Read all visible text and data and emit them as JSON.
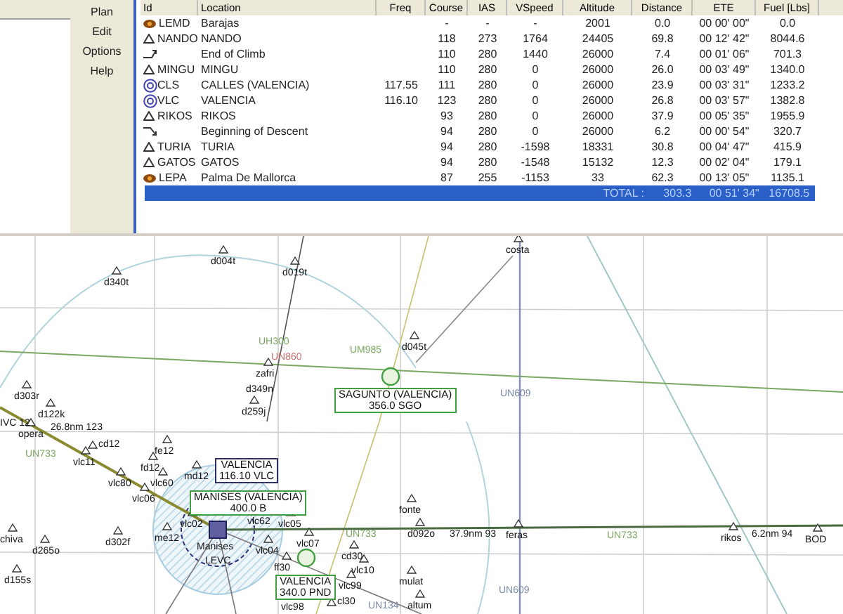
{
  "menu": [
    {
      "label": "Plan"
    },
    {
      "label": "Edit"
    },
    {
      "label": "Options"
    },
    {
      "label": "Help"
    }
  ],
  "table": {
    "columns": [
      "Id",
      "Location",
      "Freq",
      "Course",
      "IAS",
      "VSpeed",
      "Altitude",
      "Distance",
      "ETE",
      "Fuel [Lbs]"
    ],
    "rows": [
      {
        "kind": "airport",
        "id": "LEMD",
        "location": "Barajas",
        "freq": "",
        "course": "-",
        "ias": "-",
        "vspeed": "-",
        "altitude": "2001",
        "distance": "0.0",
        "ete": "00 00' 00\"",
        "fuel": "0.0"
      },
      {
        "kind": "waypoint",
        "id": "NANDO",
        "location": "NANDO",
        "freq": "",
        "course": "118",
        "ias": "273",
        "vspeed": "1764",
        "altitude": "24405",
        "distance": "69.8",
        "ete": "00 12' 42\"",
        "fuel": "8044.6"
      },
      {
        "kind": "climb",
        "id": "",
        "location": "End of Climb",
        "freq": "",
        "course": "110",
        "ias": "280",
        "vspeed": "1440",
        "altitude": "26000",
        "distance": "7.4",
        "ete": "00 01' 06\"",
        "fuel": "701.3"
      },
      {
        "kind": "waypoint",
        "id": "MINGU",
        "location": "MINGU",
        "freq": "",
        "course": "110",
        "ias": "280",
        "vspeed": "0",
        "altitude": "26000",
        "distance": "26.0",
        "ete": "00 03' 49\"",
        "fuel": "1340.0"
      },
      {
        "kind": "vor",
        "id": "CLS",
        "location": "CALLES (VALENCIA)",
        "freq": "117.55",
        "course": "111",
        "ias": "280",
        "vspeed": "0",
        "altitude": "26000",
        "distance": "23.9",
        "ete": "00 03' 31\"",
        "fuel": "1233.2"
      },
      {
        "kind": "vor",
        "id": "VLC",
        "location": "VALENCIA",
        "freq": "116.10",
        "course": "123",
        "ias": "280",
        "vspeed": "0",
        "altitude": "26000",
        "distance": "26.8",
        "ete": "00 03' 57\"",
        "fuel": "1382.8"
      },
      {
        "kind": "waypoint",
        "id": "RIKOS",
        "location": "RIKOS",
        "freq": "",
        "course": "93",
        "ias": "280",
        "vspeed": "0",
        "altitude": "26000",
        "distance": "37.9",
        "ete": "00 05' 35\"",
        "fuel": "1955.9"
      },
      {
        "kind": "descent",
        "id": "",
        "location": "Beginning of Descent",
        "freq": "",
        "course": "94",
        "ias": "280",
        "vspeed": "0",
        "altitude": "26000",
        "distance": "6.2",
        "ete": "00 00' 54\"",
        "fuel": "320.7"
      },
      {
        "kind": "waypoint",
        "id": "TURIA",
        "location": "TURIA",
        "freq": "",
        "course": "94",
        "ias": "280",
        "vspeed": "-1598",
        "altitude": "18331",
        "distance": "30.8",
        "ete": "00 04' 47\"",
        "fuel": "415.9"
      },
      {
        "kind": "waypoint",
        "id": "GATOS",
        "location": "GATOS",
        "freq": "",
        "course": "94",
        "ias": "280",
        "vspeed": "-1548",
        "altitude": "15132",
        "distance": "12.3",
        "ete": "00 02' 04\"",
        "fuel": "179.1"
      },
      {
        "kind": "airport",
        "id": "LEPA",
        "location": "Palma De Mallorca",
        "freq": "",
        "course": "87",
        "ias": "255",
        "vspeed": "-1153",
        "altitude": "33",
        "distance": "62.3",
        "ete": "00 13' 05\"",
        "fuel": "1135.1"
      }
    ],
    "total": {
      "label": "TOTAL :",
      "distance": "303.3",
      "ete": "00 51' 34\"",
      "fuel": "16708.5"
    }
  },
  "map": {
    "labels": [
      {
        "kind": "waypoint",
        "text": "d340t"
      },
      {
        "kind": "waypoint",
        "text": "d004t"
      },
      {
        "kind": "waypoint",
        "text": "d019t"
      },
      {
        "kind": "airway",
        "text": "UH300",
        "color": "#7aa860"
      },
      {
        "kind": "airway",
        "text": "UN860",
        "color": "#c87070"
      },
      {
        "kind": "waypoint",
        "text": "zafri"
      },
      {
        "kind": "waypoint",
        "text": "d349n"
      },
      {
        "kind": "waypoint",
        "text": "d259j"
      },
      {
        "kind": "airway",
        "text": "UM985",
        "color": "#7aa860"
      },
      {
        "kind": "waypoint",
        "text": "d045t"
      },
      {
        "kind": "waypoint",
        "text": "costa"
      },
      {
        "kind": "waypoint",
        "text": "d303r"
      },
      {
        "kind": "airway",
        "text": "UN609",
        "color": "#7a88a8"
      },
      {
        "kind": "waypoint",
        "text": "d122k"
      },
      {
        "kind": "distance",
        "text": "IVC 12"
      },
      {
        "kind": "waypoint",
        "text": "opera"
      },
      {
        "kind": "distance",
        "text": "26.8nm 123"
      },
      {
        "kind": "waypoint",
        "text": "cd12"
      },
      {
        "kind": "airway",
        "text": "UN733",
        "color": "#7aa860"
      },
      {
        "kind": "waypoint",
        "text": "vlc11"
      },
      {
        "kind": "waypoint",
        "text": "fe12"
      },
      {
        "kind": "waypoint",
        "text": "fd12"
      },
      {
        "kind": "waypoint",
        "text": "vlc80"
      },
      {
        "kind": "waypoint",
        "text": "vlc60"
      },
      {
        "kind": "waypoint",
        "text": "md12"
      },
      {
        "kind": "waypoint",
        "text": "vlc06"
      },
      {
        "kind": "waypoint",
        "text": "vlc02"
      },
      {
        "kind": "waypoint",
        "text": "vlc62"
      },
      {
        "kind": "waypoint",
        "text": "vlc05"
      },
      {
        "kind": "waypoint",
        "text": "chiva"
      },
      {
        "kind": "waypoint",
        "text": "d302f"
      },
      {
        "kind": "waypoint",
        "text": "me12"
      },
      {
        "kind": "waypoint",
        "text": "d265o"
      },
      {
        "kind": "waypoint",
        "text": "d155s"
      },
      {
        "kind": "distance",
        "text": "Manises"
      },
      {
        "kind": "distance",
        "text": "LEVC"
      },
      {
        "kind": "waypoint",
        "text": "vlc04"
      },
      {
        "kind": "waypoint",
        "text": "vlc07"
      },
      {
        "kind": "waypoint",
        "text": "cd30"
      },
      {
        "kind": "waypoint",
        "text": "ff30"
      },
      {
        "kind": "waypoint",
        "text": "vlc10"
      },
      {
        "kind": "waypoint",
        "text": "vlc99"
      },
      {
        "kind": "waypoint",
        "text": "mulat"
      },
      {
        "kind": "waypoint",
        "text": "vlc98"
      },
      {
        "kind": "waypoint",
        "text": "cl30"
      },
      {
        "kind": "airway",
        "text": "UN134",
        "color": "#7a88a8"
      },
      {
        "kind": "waypoint",
        "text": "altum"
      },
      {
        "kind": "waypoint",
        "text": "fonte"
      },
      {
        "kind": "airway",
        "text": "UN733",
        "color": "#7aa860"
      },
      {
        "kind": "waypoint",
        "text": "d092o"
      },
      {
        "kind": "distance",
        "text": "37.9nm 93"
      },
      {
        "kind": "waypoint",
        "text": "feras"
      },
      {
        "kind": "airway",
        "text": "UN733",
        "color": "#7aa860"
      },
      {
        "kind": "waypoint",
        "text": "rikos"
      },
      {
        "kind": "distance",
        "text": "6.2nm 94"
      },
      {
        "kind": "waypoint",
        "text": "BOD"
      },
      {
        "kind": "airway",
        "text": "UN609",
        "color": "#7a88a8"
      }
    ],
    "stations": [
      {
        "kind": "vor",
        "name": "SAGUNTO (VALENCIA)",
        "freq": "356.0 SGO"
      },
      {
        "kind": "vor",
        "name": "VALENCIA",
        "freq": "116.10 VLC"
      },
      {
        "kind": "airport",
        "name": "MANISES (VALENCIA)",
        "freq": "400.0 B"
      },
      {
        "kind": "vor",
        "name": "VALENCIA",
        "freq": "340.0 PND"
      }
    ]
  }
}
